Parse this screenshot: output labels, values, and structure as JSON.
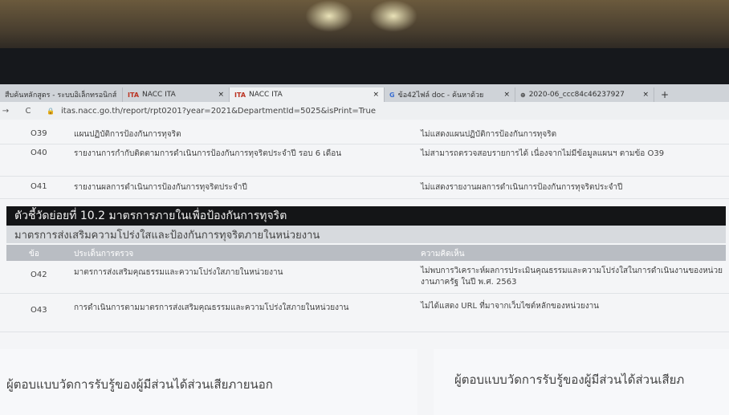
{
  "browser": {
    "tabs": [
      {
        "icon": "",
        "label": "สืบค้นหลักสูตร - ระบบอิเล็กทรอนิกส์",
        "close": "×"
      },
      {
        "icon": "ITA",
        "label": "NACC ITA",
        "close": "×"
      },
      {
        "icon": "ITA",
        "label": "NACC ITA",
        "close": "×"
      },
      {
        "icon": "G",
        "label": "ข้อ42ไฟล์ doc - ค้นหาด้วย",
        "close": "×"
      },
      {
        "icon": "⊕",
        "label": "2020-06_ccc84c46237927",
        "close": "×"
      }
    ],
    "new_tab": "+",
    "url": "itas.nacc.go.th/report/rpt0201?year=2021&DepartmentId=5025&isPrint=True"
  },
  "rows_top": [
    {
      "code": "O39",
      "item": "แผนปฏิบัติการป้องกันการทุจริต",
      "comment": "ไม่แสดงแผนปฏิบัติการป้องกันการทุจริต"
    },
    {
      "code": "O40",
      "item": "รายงานการกำกับติดตามการดำเนินการป้องกันการทุจริตประจำปี รอบ 6 เดือน",
      "comment": "ไม่สามารถตรวจสอบรายการได้ เนื่องจากไม่มีข้อมูลแผนฯ ตามข้อ O39"
    },
    {
      "code": "O41",
      "item": "รายงานผลการดำเนินการป้องกันการทุจริตประจำปี",
      "comment": "ไม่แสดงรายงานผลการดำเนินการป้องกันการทุจริตประจำปี"
    }
  ],
  "section_title": "ตัวชี้วัดย่อยที่ 10.2 มาตรการภายในเพื่อป้องกันการทุจริต",
  "subsection_title": "มาตรการส่งเสริมความโปร่งใสและป้องกันการทุจริตภายในหน่วยงาน",
  "table_head": {
    "code": "ข้อ",
    "item": "ประเด็นการตรวจ",
    "comment": "ความคิดเห็น"
  },
  "rows_bottom": [
    {
      "code": "O42",
      "item": "มาตรการส่งเสริมคุณธรรมและความโปร่งใสภายในหน่วยงาน",
      "comment": "ไม่พบการวิเคราะห์ผลการประเมินคุณธรรมและความโปร่งใสในการดำเนินงานของหน่วยงานภาครัฐ ในปี พ.ศ. 2563"
    },
    {
      "code": "O43",
      "item": "การดำเนินการตามมาตรการส่งเสริมคุณธรรมและความโปร่งใสภายในหน่วยงาน",
      "comment": "ไม่ได้แสดง URL ที่มาจากเว็บไซต์หลักของหน่วยงาน"
    }
  ],
  "footer": {
    "left": "ผู้ตอบแบบวัดการรับรู้ของผู้มีส่วนได้ส่วนเสียภายนอก",
    "right": "ผู้ตอบแบบวัดการรับรู้ของผู้มีส่วนได้ส่วนเสียภ"
  }
}
